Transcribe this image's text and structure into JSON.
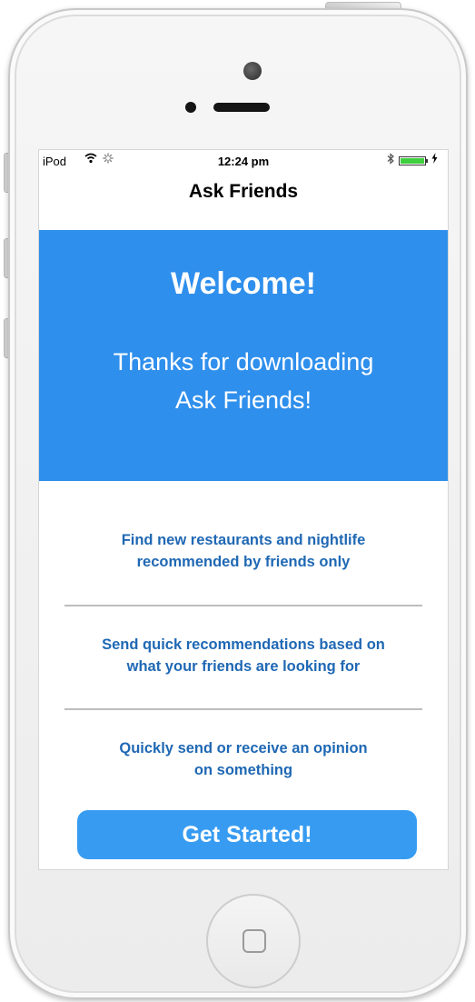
{
  "status_bar": {
    "carrier": "iPod",
    "wifi_icon": "wifi-icon",
    "activity_icon": "activity-spinner-icon",
    "time": "12:24 pm",
    "bluetooth_icon": "bluetooth-icon",
    "battery_level": 1.0,
    "charging_icon": "charging-bolt-icon"
  },
  "nav": {
    "title": "Ask Friends"
  },
  "hero": {
    "title": "Welcome!",
    "subtitle_line1": "Thanks for downloading",
    "subtitle_line2": "Ask Friends!"
  },
  "features": [
    {
      "line1": "Find new restaurants and nightlife",
      "line2": "recommended by friends only"
    },
    {
      "line1": "Send quick recommendations based on",
      "line2": "what your friends are looking for"
    },
    {
      "line1": "Quickly send or receive an opinion",
      "line2": "on something"
    }
  ],
  "cta": {
    "label": "Get Started!"
  },
  "colors": {
    "hero_background": "#2f8fec",
    "feature_text": "#1f68b4",
    "button_background": "#379cf1",
    "battery_fill": "#3fcf3f"
  }
}
